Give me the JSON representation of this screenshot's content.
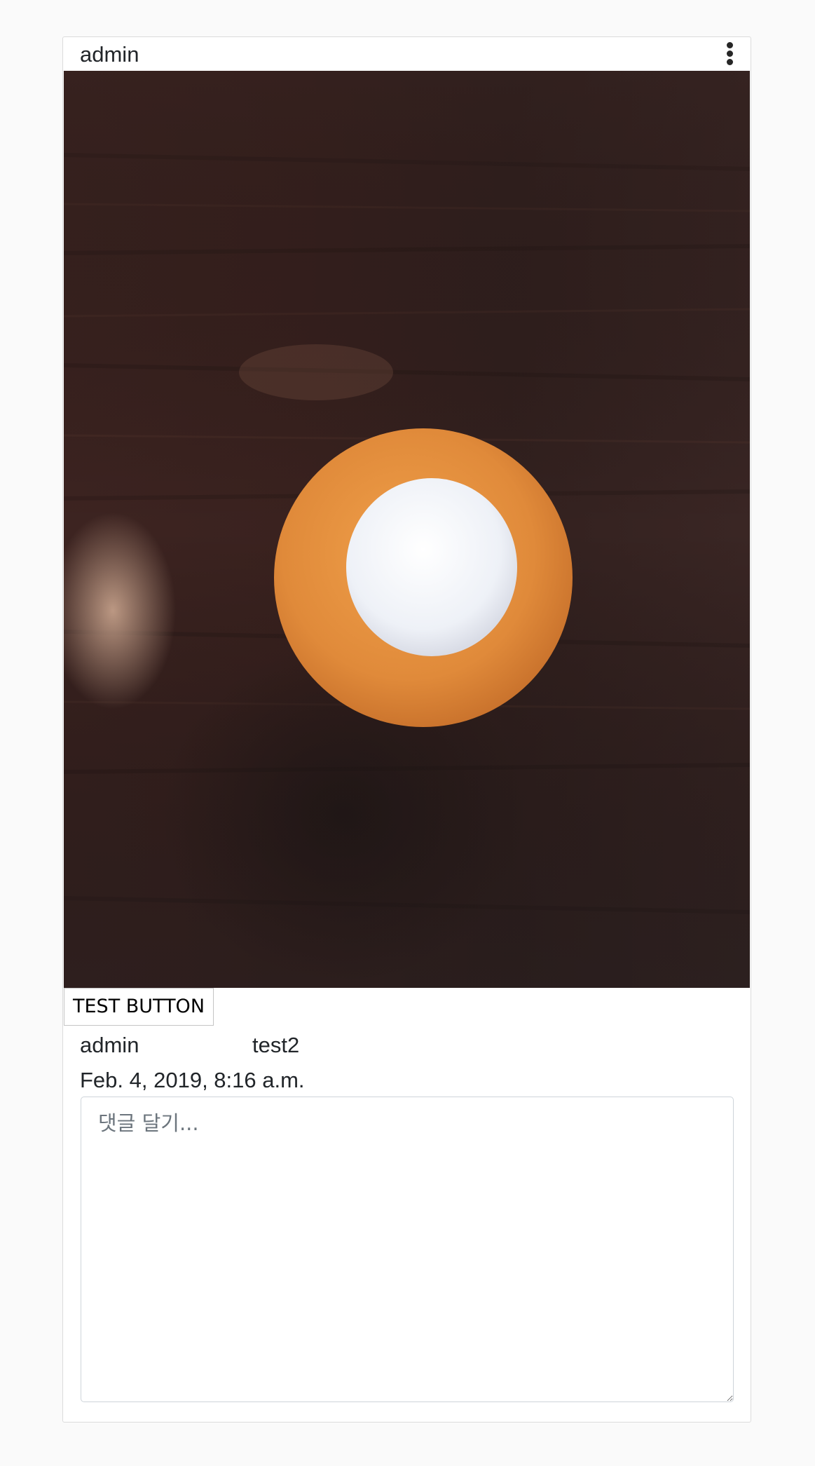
{
  "post": {
    "author": "admin",
    "menu_icon": "more-vertical-icon",
    "photo_alt": "latte",
    "test_button_label": "TEST BUTTON",
    "content_author": "admin",
    "content_text": "test2",
    "date": "Feb. 4, 2019, 8:16 a.m.",
    "comment_placeholder": "댓글 달기..."
  },
  "colors": {
    "page_bg": "#fafafa",
    "card_border": "#dbdbdb",
    "table_wood": "#3a2422",
    "cup_orange": "#e08a3a",
    "foam": "#f2f4f8"
  }
}
